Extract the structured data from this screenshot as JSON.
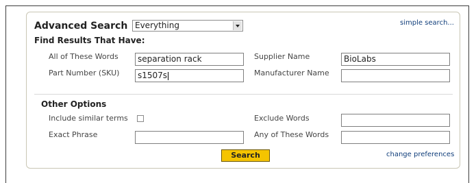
{
  "advanced_search": {
    "title": "Advanced Search",
    "scope_select": {
      "value": "Everything"
    },
    "simple_search_link": "simple search...",
    "find_results": {
      "heading": "Find Results That Have:",
      "all_words": {
        "label": "All of These Words",
        "value": "separation rack"
      },
      "part_number": {
        "label": "Part Number (SKU)",
        "value": "s1507s"
      },
      "supplier_name": {
        "label": "Supplier Name",
        "value": "BioLabs"
      },
      "manufacturer_name": {
        "label": "Manufacturer Name",
        "value": ""
      }
    },
    "other_options": {
      "heading": "Other Options",
      "include_similar": {
        "label": "Include similar terms",
        "checked": false
      },
      "exclude_words": {
        "label": "Exclude Words",
        "value": ""
      },
      "exact_phrase": {
        "label": "Exact Phrase",
        "value": ""
      },
      "any_words": {
        "label": "Any of These Words",
        "value": ""
      }
    },
    "search_button": "Search",
    "change_preferences_link": "change preferences"
  },
  "colors": {
    "button": "#f5c400",
    "link": "#0f3d7a",
    "panel_border": "#c9c6b4"
  }
}
